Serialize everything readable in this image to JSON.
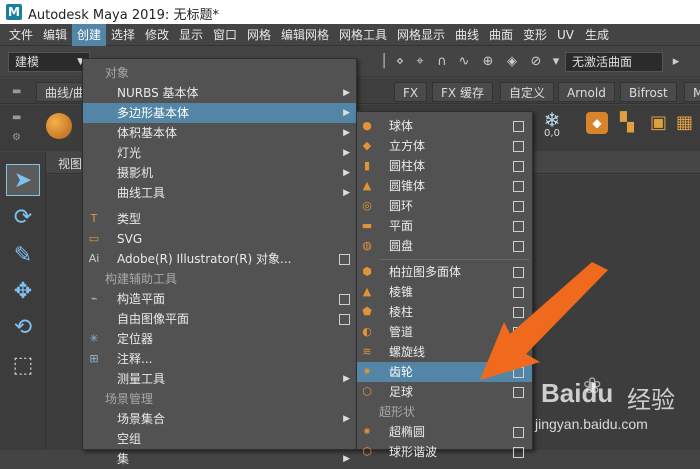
{
  "window": {
    "title": "Autodesk Maya 2019: 无标题*",
    "logo": "M"
  },
  "menubar": [
    "文件",
    "编辑",
    "创建",
    "选择",
    "修改",
    "显示",
    "窗口",
    "网格",
    "编辑网格",
    "网格工具",
    "网格显示",
    "曲线",
    "曲面",
    "变形",
    "UV",
    "生成"
  ],
  "toolbar": {
    "mode": "建模",
    "inactive_surface": "无激活曲面"
  },
  "shelf_tabs": [
    "曲线/曲",
    "FX",
    "FX 缓存",
    "自定义",
    "Arnold",
    "Bifrost",
    "M"
  ],
  "shelf_value": "0,0",
  "viewport": {
    "tab_label": "视图"
  },
  "create_menu": {
    "header": "对象",
    "items": [
      {
        "label": "NURBS 基本体",
        "type": "sub"
      },
      {
        "label": "多边形基本体",
        "type": "sub"
      },
      {
        "label": "体积基本体",
        "type": "sub"
      },
      {
        "label": "灯光",
        "type": "sub"
      },
      {
        "label": "摄影机",
        "type": "sub"
      },
      {
        "label": "曲线工具",
        "type": "sub"
      }
    ],
    "items2": [
      {
        "label": "类型",
        "type": "plain"
      },
      {
        "label": "SVG",
        "type": "plain"
      },
      {
        "label": "Adobe(R) Illustrator(R) 对象...",
        "type": "box"
      }
    ],
    "section2": "构建辅助工具",
    "items3": [
      {
        "label": "构造平面",
        "type": "box"
      },
      {
        "label": "自由图像平面",
        "type": "box"
      },
      {
        "label": "定位器",
        "type": "plain"
      },
      {
        "label": "注释...",
        "type": "plain"
      },
      {
        "label": "测量工具",
        "type": "sub"
      }
    ],
    "section3": "场景管理",
    "items4": [
      {
        "label": "场景集合",
        "type": "sub"
      },
      {
        "label": "空组",
        "type": "plain"
      },
      {
        "label": "集",
        "type": "sub"
      }
    ]
  },
  "poly_menu": {
    "group1": [
      "球体",
      "立方体",
      "圆柱体",
      "圆锥体",
      "圆环",
      "平面",
      "圆盘"
    ],
    "group2": [
      "柏拉图多面体",
      "棱锥",
      "棱柱",
      "管道",
      "螺旋线",
      "齿轮",
      "足球"
    ],
    "section": "超形状",
    "group3": [
      "超椭圆",
      "球形谐波"
    ],
    "highlighted": "齿轮"
  },
  "watermark": {
    "brand": "Baidu",
    "brand_cn": "经验",
    "url": "jingyan.baidu.com"
  },
  "colors": {
    "highlight": "#5285a6",
    "arrow": "#f06a1e",
    "menu_bg": "#525252",
    "accent_icon": "#7ec2f0"
  }
}
